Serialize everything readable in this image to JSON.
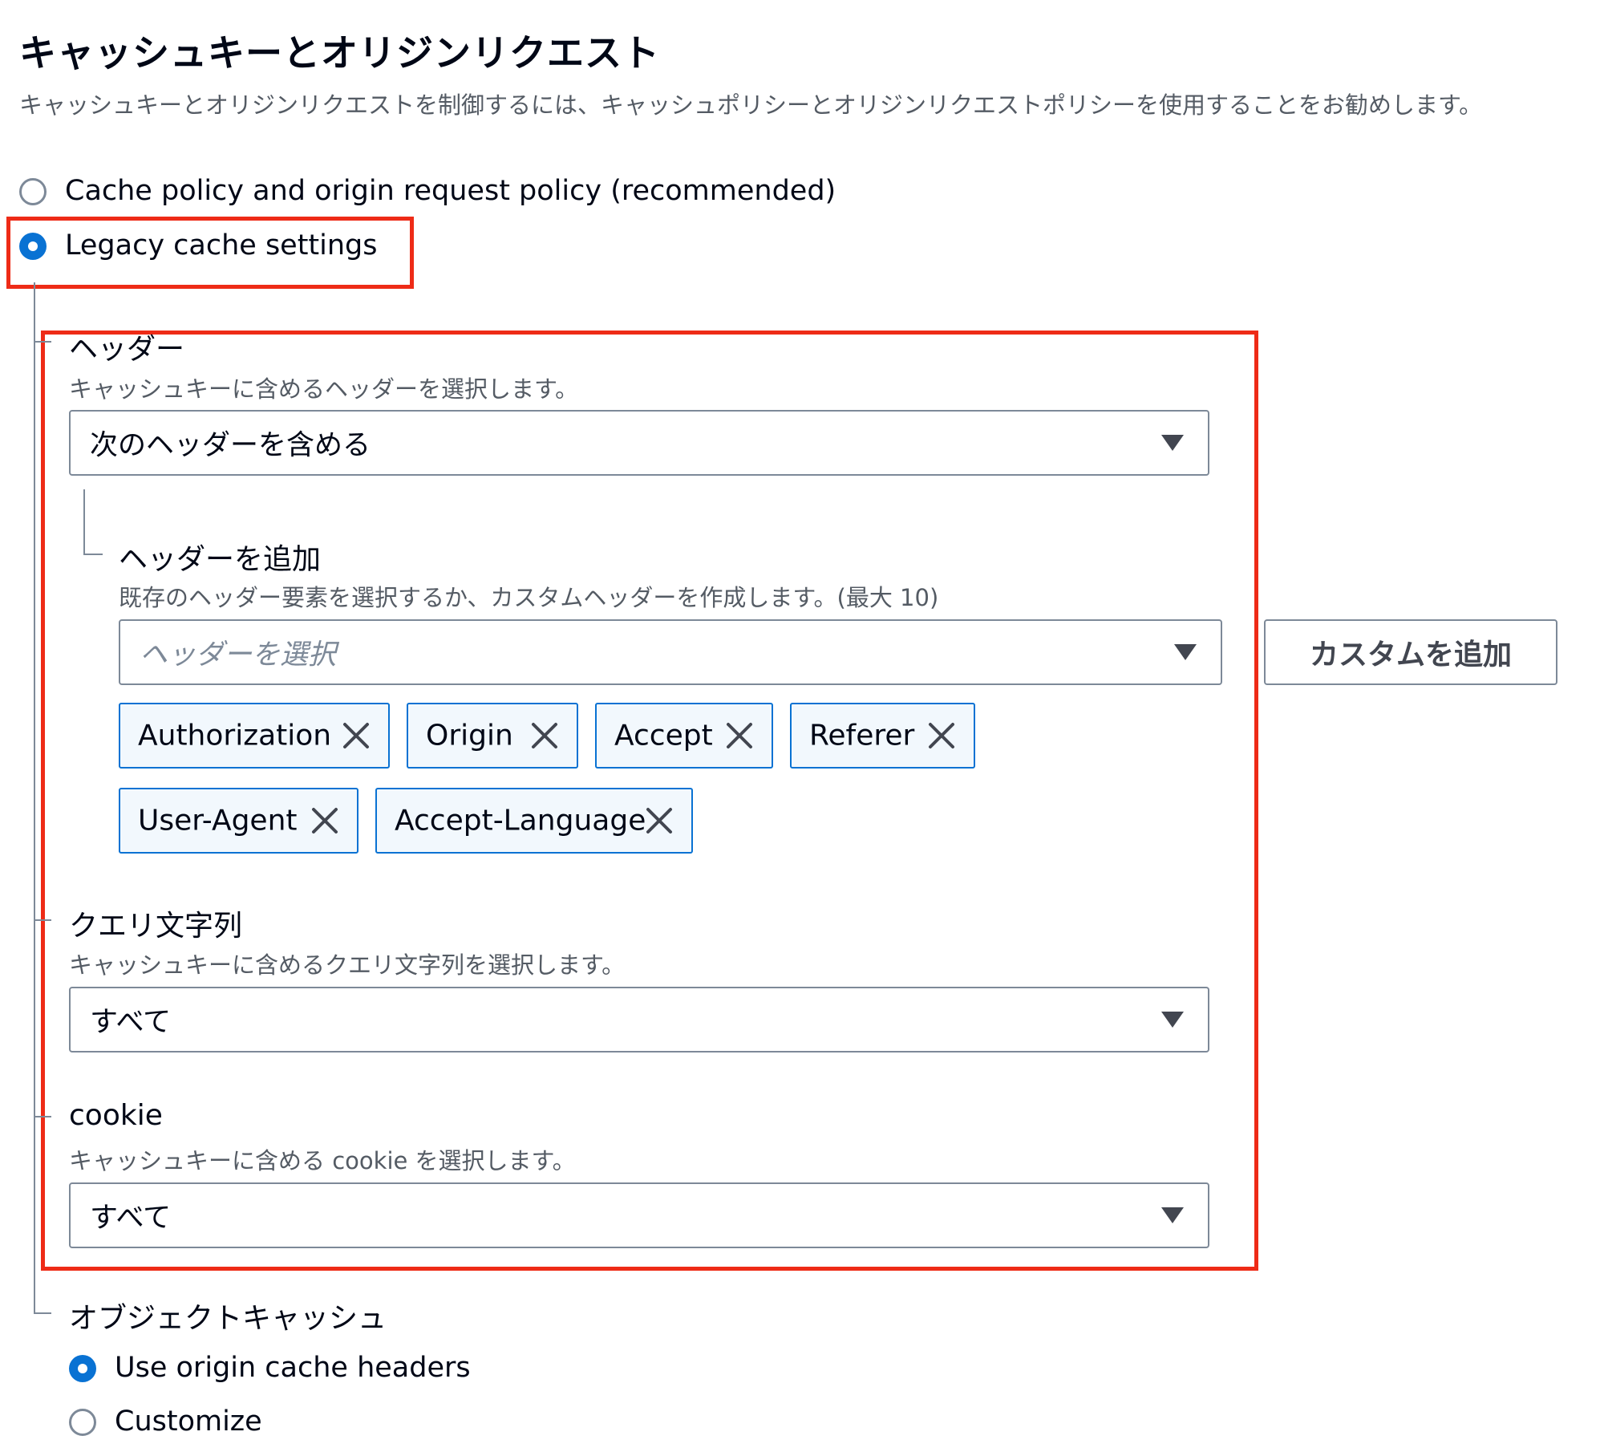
{
  "header": {
    "title": "キャッシュキーとオリジンリクエスト",
    "description": "キャッシュキーとオリジンリクエストを制御するには、キャッシュポリシーとオリジンリクエストポリシーを使用することをお勧めします。"
  },
  "settings_mode": {
    "options": [
      {
        "label": "Cache policy and origin request policy (recommended)",
        "selected": false
      },
      {
        "label": "Legacy cache settings",
        "selected": true
      }
    ]
  },
  "headers": {
    "label": "ヘッダー",
    "description": "キャッシュキーに含めるヘッダーを選択します。",
    "selected": "次のヘッダーを含める",
    "add": {
      "label": "ヘッダーを追加",
      "description": "既存のヘッダー要素を選択するか、カスタムヘッダーを作成します。(最大 10)",
      "placeholder": "ヘッダーを選択",
      "custom_button": "カスタムを追加"
    },
    "tokens": [
      "Authorization",
      "Origin",
      "Accept",
      "Referer",
      "User-Agent",
      "Accept-Language"
    ]
  },
  "query_strings": {
    "label": "クエリ文字列",
    "description": "キャッシュキーに含めるクエリ文字列を選択します。",
    "selected": "すべて"
  },
  "cookies": {
    "label": "cookie",
    "description": "キャッシュキーに含める cookie を選択します。",
    "selected": "すべて"
  },
  "object_cache": {
    "label": "オブジェクトキャッシュ",
    "options": [
      {
        "label": "Use origin cache headers",
        "selected": true
      },
      {
        "label": "Customize",
        "selected": false
      }
    ]
  },
  "colors": {
    "accent": "#0972d3",
    "highlight": "#ee2b17",
    "token_bg": "#f2f8fd"
  }
}
